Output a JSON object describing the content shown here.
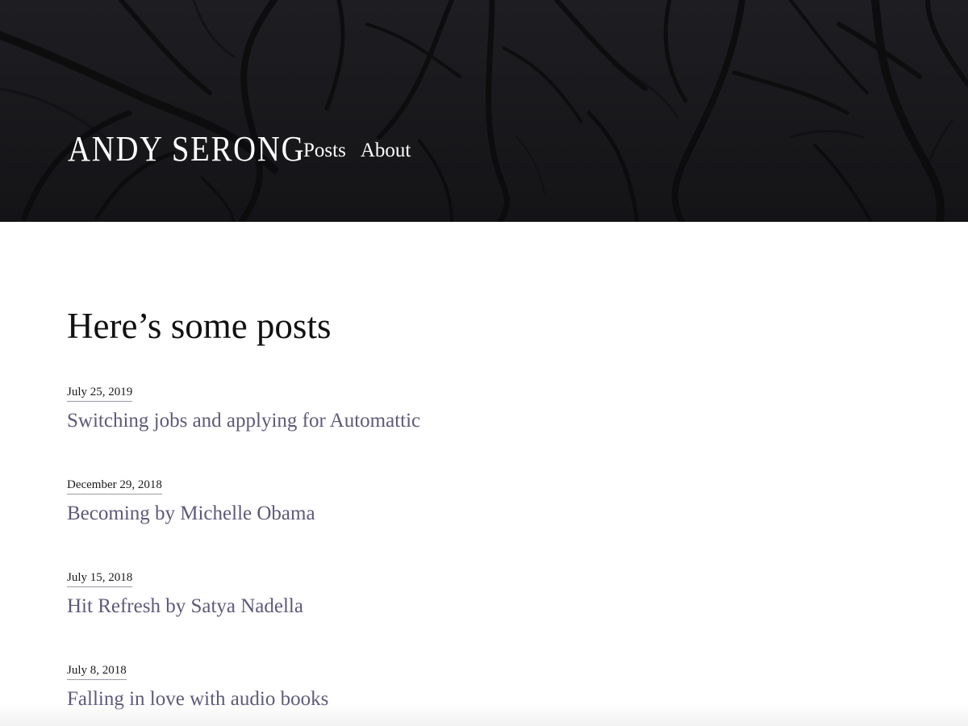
{
  "header": {
    "logo_text": "ANDY SERONG",
    "nav": [
      {
        "label": "Posts"
      },
      {
        "label": "About"
      }
    ]
  },
  "main": {
    "title": "Here’s some posts",
    "posts": [
      {
        "date": "July 25, 2019",
        "title": "Switching jobs and applying for Automattic"
      },
      {
        "date": "December 29, 2018",
        "title": "Becoming by Michelle Obama"
      },
      {
        "date": "July 15, 2018",
        "title": "Hit Refresh by Satya Nadella"
      },
      {
        "date": "July 8, 2018",
        "title": "Falling in love with audio books"
      }
    ]
  },
  "colors": {
    "header_background": "#17171a",
    "link_color": "#5d5a79",
    "date_underline": "#9c9aa8",
    "text": "#111111"
  }
}
